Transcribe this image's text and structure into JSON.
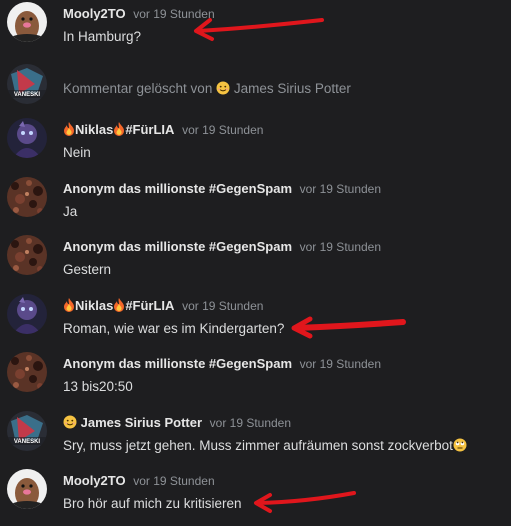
{
  "messages": [
    {
      "author": "Mooly2TO",
      "time": "vor 19 Stunden",
      "text": "In Hamburg?"
    },
    {
      "deleted_prefix": "Kommentar gelöscht von",
      "deleted_by": "James Sirius Potter"
    },
    {
      "author": "Niklas",
      "author_suffix": "#FürLIA",
      "time": "vor 19 Stunden",
      "text": "Nein"
    },
    {
      "author": "Anonym das millionste #GegenSpam",
      "time": "vor 19 Stunden",
      "text": "Ja"
    },
    {
      "author": "Anonym das millionste #GegenSpam",
      "time": "vor 19 Stunden",
      "text": "Gestern"
    },
    {
      "author": "Niklas",
      "author_suffix": "#FürLIA",
      "time": "vor 19 Stunden",
      "text": "Roman, wie war es im Kindergarten?"
    },
    {
      "author": "Anonym das millionste #GegenSpam",
      "time": "vor 19 Stunden",
      "text": "13 bis20:50"
    },
    {
      "author": "James Sirius Potter",
      "time": "vor 19 Stunden",
      "text": "Sry, muss jetzt gehen. Muss zimmer aufräumen sonst zockverbot"
    },
    {
      "author": "Mooly2TO",
      "time": "vor 19 Stunden",
      "text": "Bro hör auf mich zu kritisieren"
    }
  ],
  "avatar_texts": {
    "vane": "VANESKI"
  },
  "colors": {
    "background": "#1e1e20",
    "annotation_arrow": "#e0161c",
    "muted": "#8e9297"
  }
}
